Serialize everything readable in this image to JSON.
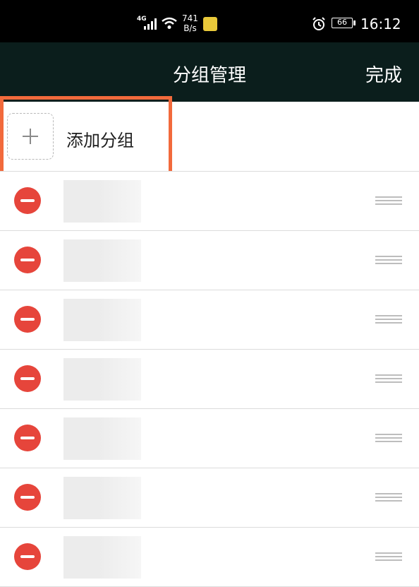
{
  "status_bar": {
    "network": "4G",
    "speed_value": "741",
    "speed_unit": "B/s",
    "battery": "66",
    "time": "16:12"
  },
  "header": {
    "title": "分组管理",
    "done_label": "完成"
  },
  "add_group": {
    "label": "添加分组",
    "icon": "plus-icon"
  },
  "groups": [
    {
      "name": ""
    },
    {
      "name": ""
    },
    {
      "name": ""
    },
    {
      "name": ""
    },
    {
      "name": ""
    },
    {
      "name": ""
    },
    {
      "name": ""
    }
  ],
  "colors": {
    "header_bg": "#0b1e1c",
    "remove_red": "#e6453b",
    "highlight_orange": "#f26a3c"
  }
}
